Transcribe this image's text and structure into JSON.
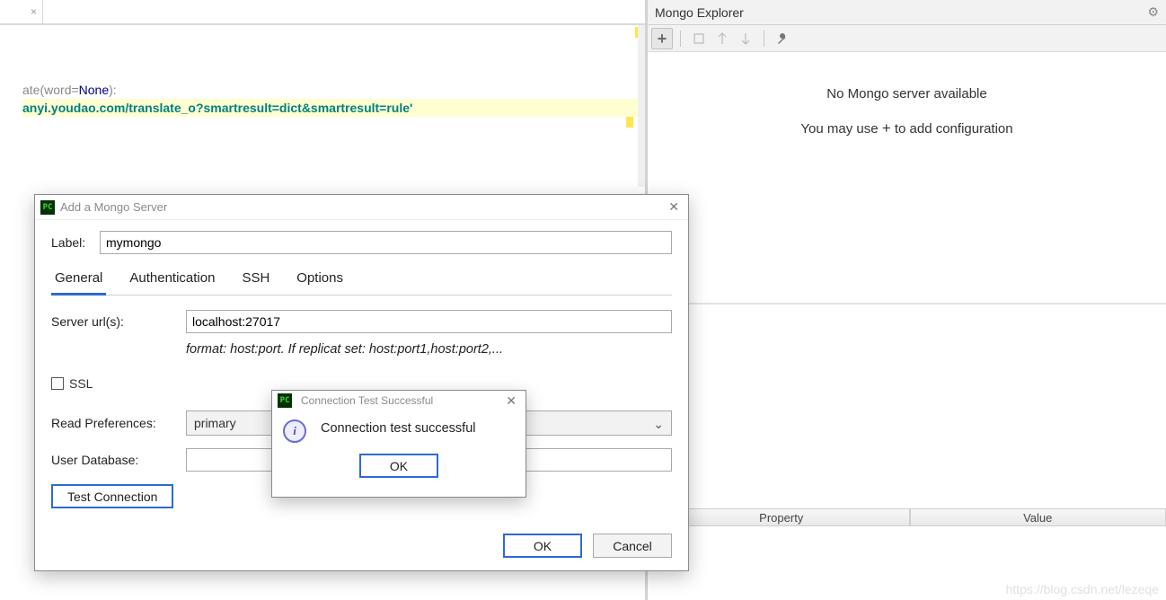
{
  "editor": {
    "code_line1_part1": "ate",
    "code_line1_part2": "(word=",
    "code_line1_part3": "None",
    "code_line1_part4": "):",
    "code_line2": "anyi.youdao.com/translate_o?smartresult=dict&smartresult=rule'"
  },
  "panel": {
    "title": "Mongo Explorer",
    "gear_icon": "⚙",
    "toolbar": {
      "add": "+",
      "wrench": "🔧"
    },
    "no_server": "No Mongo server available",
    "may_use_prefix": "You may use ",
    "may_use_plus": "+",
    "may_use_suffix": " to add configuration",
    "col_property": "Property",
    "col_value": "Value"
  },
  "dialog": {
    "title": "Add a Mongo Server",
    "icon_text": "PC",
    "label_field": "Label:",
    "label_value": "mymongo",
    "tabs": {
      "general": "General",
      "authentication": "Authentication",
      "ssh": "SSH",
      "options": "Options"
    },
    "server_url_label": "Server url(s):",
    "server_url_value": "localhost:27017",
    "format_hint": "format: host:port. If replicat set: host:port1,host:port2,...",
    "ssl_label": "SSL",
    "read_pref_label": "Read  Preferences:",
    "read_pref_value": "primary",
    "user_db_label": "User Database:",
    "user_db_value": "",
    "test_connection": "Test Connection",
    "ok": "OK",
    "cancel": "Cancel"
  },
  "info": {
    "title": "Connection Test Successful",
    "icon_text": "PC",
    "i_glyph": "i",
    "message": "Connection test successful",
    "ok": "OK"
  },
  "watermark": "https://blog.csdn.net/lezeqe"
}
